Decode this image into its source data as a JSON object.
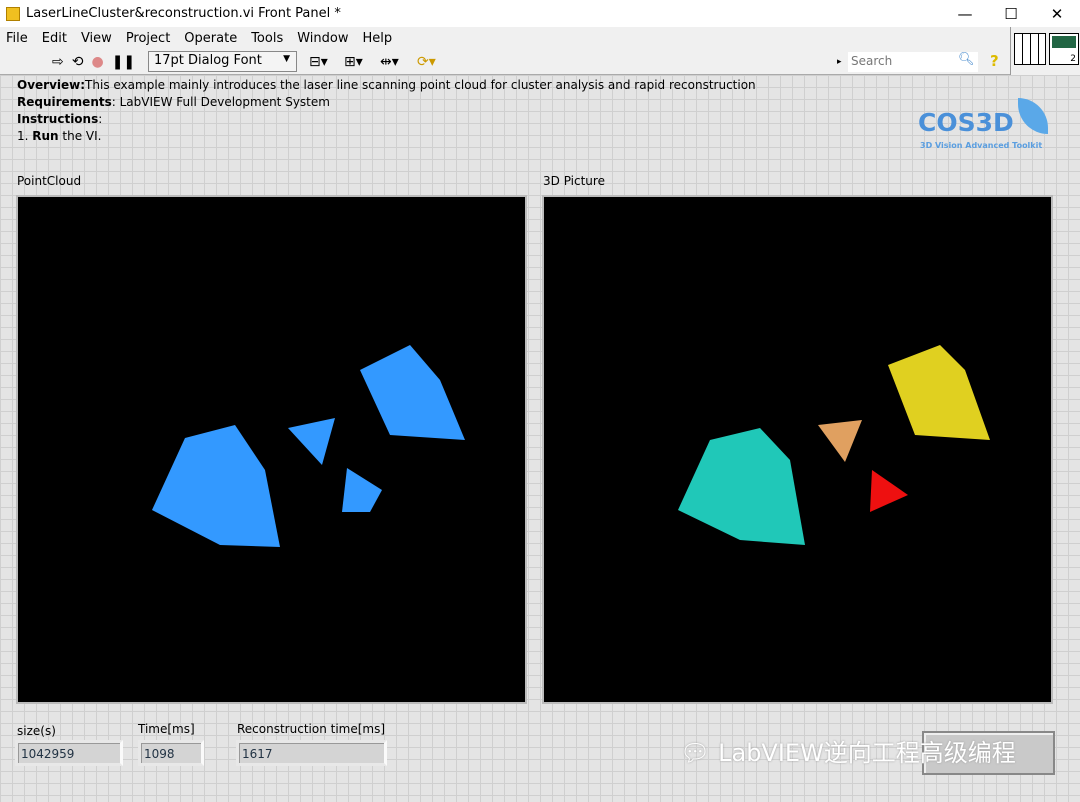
{
  "window": {
    "title": "LaserLineCluster&reconstruction.vi Front Panel *",
    "minimize": "—",
    "maximize": "☐",
    "close": "✕"
  },
  "menu": [
    "File",
    "Edit",
    "View",
    "Project",
    "Operate",
    "Tools",
    "Window",
    "Help"
  ],
  "toolbar": {
    "font": "17pt Dialog Font",
    "search_placeholder": "Search",
    "help": "?",
    "connector_count": "2"
  },
  "description": {
    "overview_label": "Overview:",
    "overview": "This example mainly introduces the laser line scanning point cloud for cluster analysis and rapid reconstruction",
    "requirements_label": "Requirements",
    "requirements": ": LabVIEW Full Development System",
    "instructions_label": "Instructions",
    "instructions_colon": ":",
    "step_prefix": "1. ",
    "step_bold": "Run",
    "step_rest": " the VI."
  },
  "logo": {
    "name": "COS3D",
    "tagline": "3D Vision Advanced Toolkit"
  },
  "pointcloud": {
    "label": "PointCloud",
    "color": "#3399ff"
  },
  "picture": {
    "label": "3D Picture",
    "cluster_colors": [
      "#20c8b8",
      "#e0d020",
      "#e0a060",
      "#ee1010"
    ]
  },
  "indicators": [
    {
      "label": "size(s)",
      "value": "1042959"
    },
    {
      "label": "Time[ms]",
      "value": "1098"
    },
    {
      "label": "Reconstruction time[ms]",
      "value": "1617"
    }
  ],
  "watermark": "LabVIEW逆向工程高级编程"
}
